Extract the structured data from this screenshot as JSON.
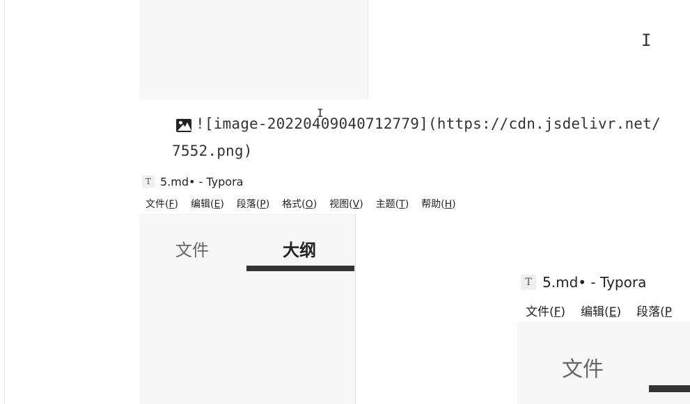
{
  "editor": {
    "markdown_line1": "![image-20220409040712779](https://cdn.jsdelivr.net/",
    "markdown_line2": "7552.png)",
    "cursor_glyph": "I"
  },
  "embedded_window_1": {
    "title": "5.md• - Typora",
    "logo_letter": "T",
    "menu": [
      {
        "label": "文件(",
        "key": "F",
        "close": ")"
      },
      {
        "label": "编辑(",
        "key": "E",
        "close": ")"
      },
      {
        "label": "段落(",
        "key": "P",
        "close": ")"
      },
      {
        "label": "格式(",
        "key": "O",
        "close": ")"
      },
      {
        "label": "视图(",
        "key": "V",
        "close": ")"
      },
      {
        "label": "主题(",
        "key": "T",
        "close": ")"
      },
      {
        "label": "帮助(",
        "key": "H",
        "close": ")"
      }
    ],
    "tabs": {
      "files": "文件",
      "outline": "大纲"
    }
  },
  "embedded_window_2": {
    "title": "5.md• - Typora",
    "logo_letter": "T",
    "menu": [
      {
        "label": "文件(",
        "key": "F",
        "close": ")"
      },
      {
        "label": "编辑(",
        "key": "E",
        "close": ")"
      },
      {
        "label": "段落(",
        "key": "P",
        "close": ""
      }
    ],
    "tabs": {
      "files": "文件"
    }
  },
  "colors": {
    "panel_bg": "#f7f7f7",
    "text": "#333333",
    "underline": "#333333"
  }
}
